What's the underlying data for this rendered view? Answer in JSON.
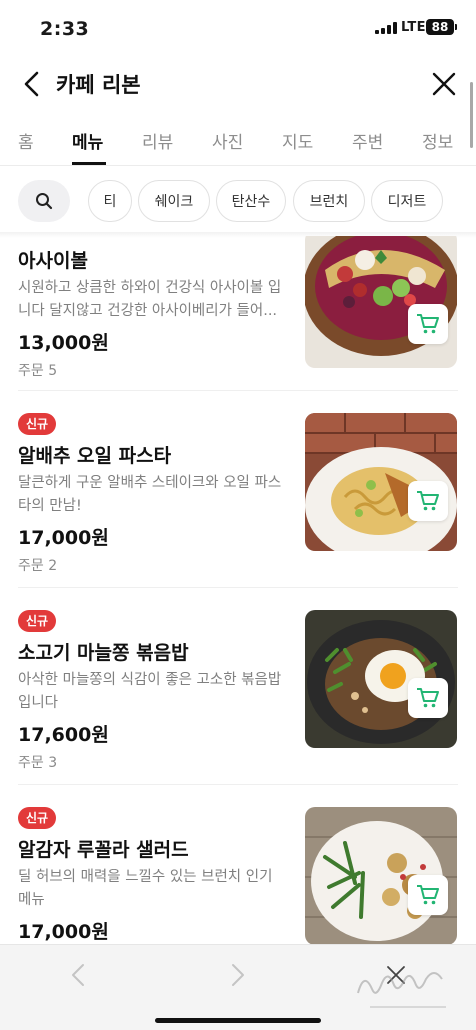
{
  "status_bar": {
    "time": "2:33",
    "network": "LTE",
    "battery": "88"
  },
  "header": {
    "title": "카페 리본",
    "back_icon": "chevron-left-icon",
    "close_icon": "close-icon"
  },
  "tabs": [
    {
      "label": "홈",
      "active": false
    },
    {
      "label": "메뉴",
      "active": true
    },
    {
      "label": "리뷰",
      "active": false
    },
    {
      "label": "사진",
      "active": false
    },
    {
      "label": "지도",
      "active": false
    },
    {
      "label": "주변",
      "active": false
    },
    {
      "label": "정보",
      "active": false
    }
  ],
  "filters": {
    "search_icon": "search-icon",
    "chips": [
      "티",
      "쉐이크",
      "탄산수",
      "브런치",
      "디저트"
    ]
  },
  "menu_items": [
    {
      "name": "아사이볼",
      "description": "시원하고 상큼한 하와이 건강식 아사이볼 입니다 달지않고 건강한 아사이베리가 들어...",
      "price": "13,000원",
      "orders": "주문 5",
      "badge": ""
    },
    {
      "name": "알배추 오일 파스타",
      "description": "달큰하게 구운 알배추 스테이크와 오일 파스타의 만남!",
      "price": "17,000원",
      "orders": "주문 2",
      "badge": "신규"
    },
    {
      "name": "소고기 마늘쫑 볶음밥",
      "description": "아삭한 마늘쫑의 식감이 좋은 고소한 볶음밥 입니다",
      "price": "17,600원",
      "orders": "주문 3",
      "badge": "신규"
    },
    {
      "name": "알감자 루꼴라 샐러드",
      "description": "딜 허브의 매력을 느낄수 있는 브런치 인기 메뉴",
      "price": "17,000원",
      "orders": "",
      "badge": "신규"
    }
  ],
  "bottom_bar": {
    "back_icon": "chevron-left-icon",
    "forward_icon": "chevron-right-icon",
    "close_icon": "close-icon"
  },
  "colors": {
    "badge": "#e23a3a",
    "cart": "#22b573",
    "active_tab": "#111111"
  }
}
